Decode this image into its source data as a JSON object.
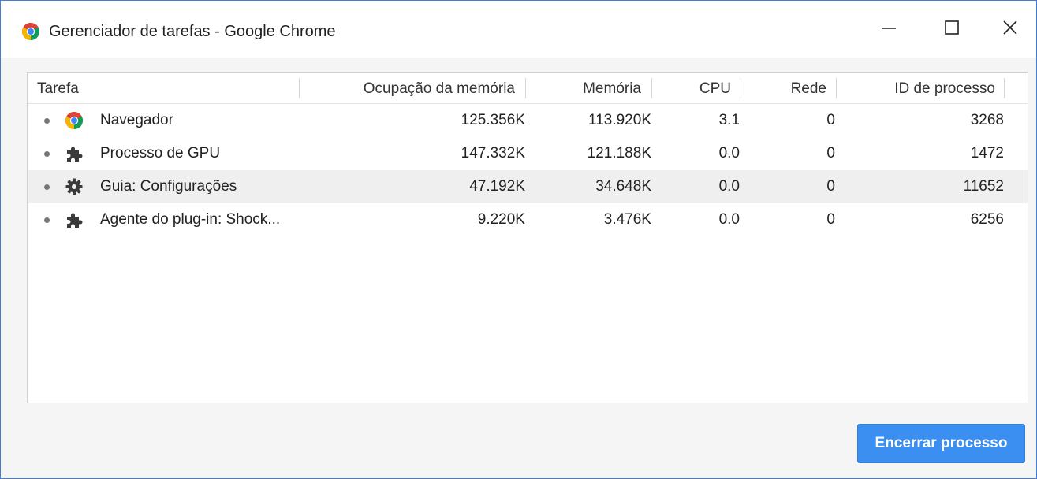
{
  "window": {
    "title": "Gerenciador de tarefas - Google Chrome",
    "accent_color": "#3d7fd6"
  },
  "table": {
    "columns": [
      "Tarefa",
      "Ocupação da memória",
      "Memória",
      "CPU",
      "Rede",
      "ID de processo"
    ],
    "rows": [
      {
        "icon": "chrome-icon",
        "task": "Navegador",
        "footprint": "125.356K",
        "memory": "113.920K",
        "cpu": "3.1",
        "network": "0",
        "pid": "3268",
        "selected": false
      },
      {
        "icon": "puzzle-icon",
        "task": "Processo de GPU",
        "footprint": "147.332K",
        "memory": "121.188K",
        "cpu": "0.0",
        "network": "0",
        "pid": "1472",
        "selected": false
      },
      {
        "icon": "gear-icon",
        "task": "Guia: Configurações",
        "footprint": "47.192K",
        "memory": "34.648K",
        "cpu": "0.0",
        "network": "0",
        "pid": "11652",
        "selected": true
      },
      {
        "icon": "puzzle-icon",
        "task": "Agente do plug-in: Shock...",
        "footprint": "9.220K",
        "memory": "3.476K",
        "cpu": "0.0",
        "network": "0",
        "pid": "6256",
        "selected": false
      }
    ]
  },
  "footer": {
    "end_process_label": "Encerrar processo",
    "button_color": "#3b8ff0"
  }
}
